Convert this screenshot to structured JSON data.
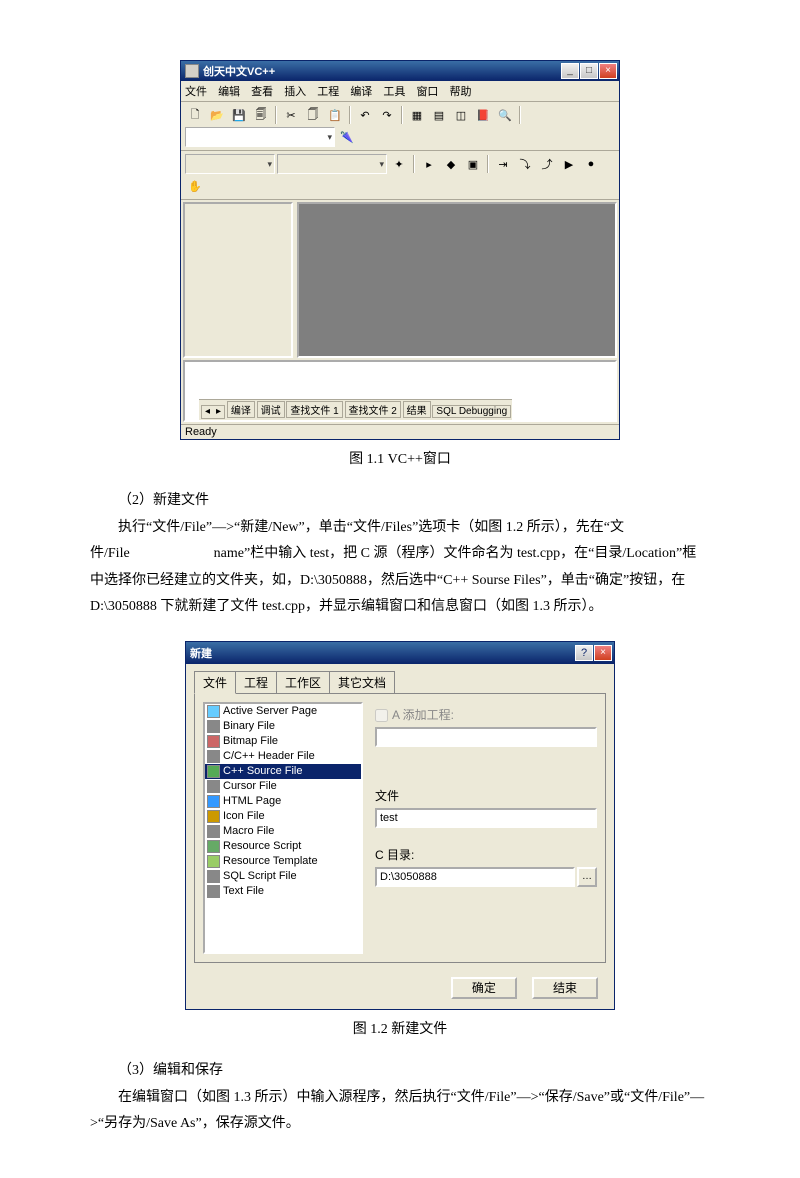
{
  "vc": {
    "title": "创天中文VC++",
    "menus": [
      "文件",
      "编辑",
      "查看",
      "插入",
      "工程",
      "编译",
      "工具",
      "窗口",
      "帮助"
    ],
    "bot_tabs": [
      "编译",
      "调试",
      "查找文件 1",
      "查找文件 2",
      "结果",
      "SQL Debugging"
    ],
    "status": "Ready"
  },
  "cap1": "图 1.1   VC++窗口",
  "p2a": "（2）新建文件",
  "p2b": "执行“文件/File”—>“新建/New”，单击“文件/Files”选项卡（如图 1.2 所示），先在“文件/File      name”栏中输入 test，把 C 源（程序）文件命名为 test.cpp，在“目录/Location”框中选择你已经建立的文件夹，如，D:\\3050888，然后选中“C++ Sourse Files”，单击“确定”按钮，在 D:\\3050888 下就新建了文件 test.cpp，并显示编辑窗口和信息窗口（如图 1.3 所示）。",
  "dlg": {
    "title": "新建",
    "tabs": [
      "文件",
      "工程",
      "工作区",
      "其它文档"
    ],
    "items": [
      "Active Server Page",
      "Binary File",
      "Bitmap File",
      "C/C++ Header File",
      "C++ Source File",
      "Cursor File",
      "HTML Page",
      "Icon File",
      "Macro File",
      "Resource Script",
      "Resource Template",
      "SQL Script File",
      "Text File"
    ],
    "selected_idx": 4,
    "chk_label": "A 添加工程:",
    "file_label": "文件",
    "file_value": "test",
    "dir_label": "C 目录:",
    "dir_value": "D:\\3050888",
    "ok": "确定",
    "cancel": "结束"
  },
  "cap2": "图 1.2   新建文件",
  "p3a": "（3）编辑和保存",
  "p3b": "在编辑窗口（如图 1.3 所示）中输入源程序，然后执行“文件/File”—>“保存/Save”或“文件/File”—>“另存为/Save As”，保存源文件。"
}
